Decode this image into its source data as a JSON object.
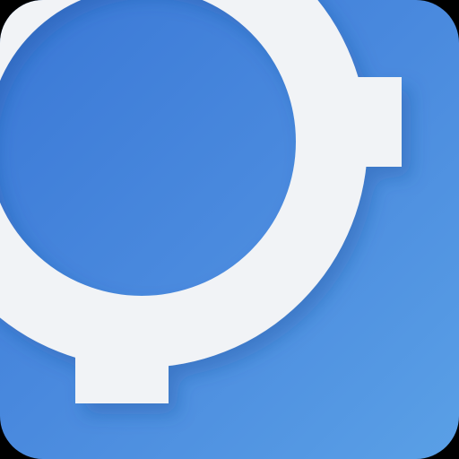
{
  "icon": {
    "name": "gear-icon",
    "colors": {
      "background_start": "#3a78d6",
      "background_end": "#5aa0e6",
      "glyph": "#f1f3f6"
    }
  }
}
